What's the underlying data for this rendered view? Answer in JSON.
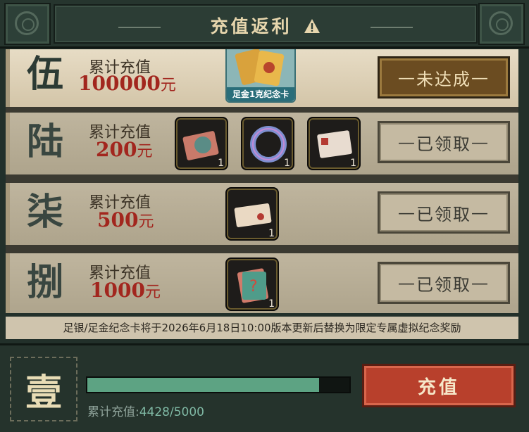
{
  "header": {
    "title": "充值返利",
    "warn_icon": "warning-icon"
  },
  "tiers": [
    {
      "rank": "伍",
      "label": "累计充值",
      "amount": "100000",
      "unit": "元",
      "button": "未达成",
      "state": "not-reached",
      "reward_caption": "足金1克纪念卡"
    },
    {
      "rank": "陆",
      "label": "累计充值",
      "amount": "200",
      "unit": "元",
      "button": "已领取",
      "state": "claimed",
      "rewards": [
        {
          "count": "1"
        },
        {
          "count": "1"
        },
        {
          "count": "1"
        }
      ]
    },
    {
      "rank": "柒",
      "label": "累计充值",
      "amount": "500",
      "unit": "元",
      "button": "已领取",
      "state": "claimed",
      "rewards": [
        {
          "count": "1"
        }
      ]
    },
    {
      "rank": "捌",
      "label": "累计充值",
      "amount": "1000",
      "unit": "元",
      "button": "已领取",
      "state": "claimed",
      "rewards": [
        {
          "count": "1"
        }
      ]
    }
  ],
  "notice": "足银/足金纪念卡将于2026年6月18日10:00版本更新后替换为限定专属虚拟纪念奖励",
  "footer": {
    "rank": "壹",
    "progress_label": "累计充值:",
    "progress_value": "4428/5000",
    "progress_fraction": 0.8856,
    "charge_button": "充值"
  },
  "colors": {
    "accent_red": "#b8402c",
    "progress_green": "#5da383",
    "amount_red": "#a2261e"
  }
}
